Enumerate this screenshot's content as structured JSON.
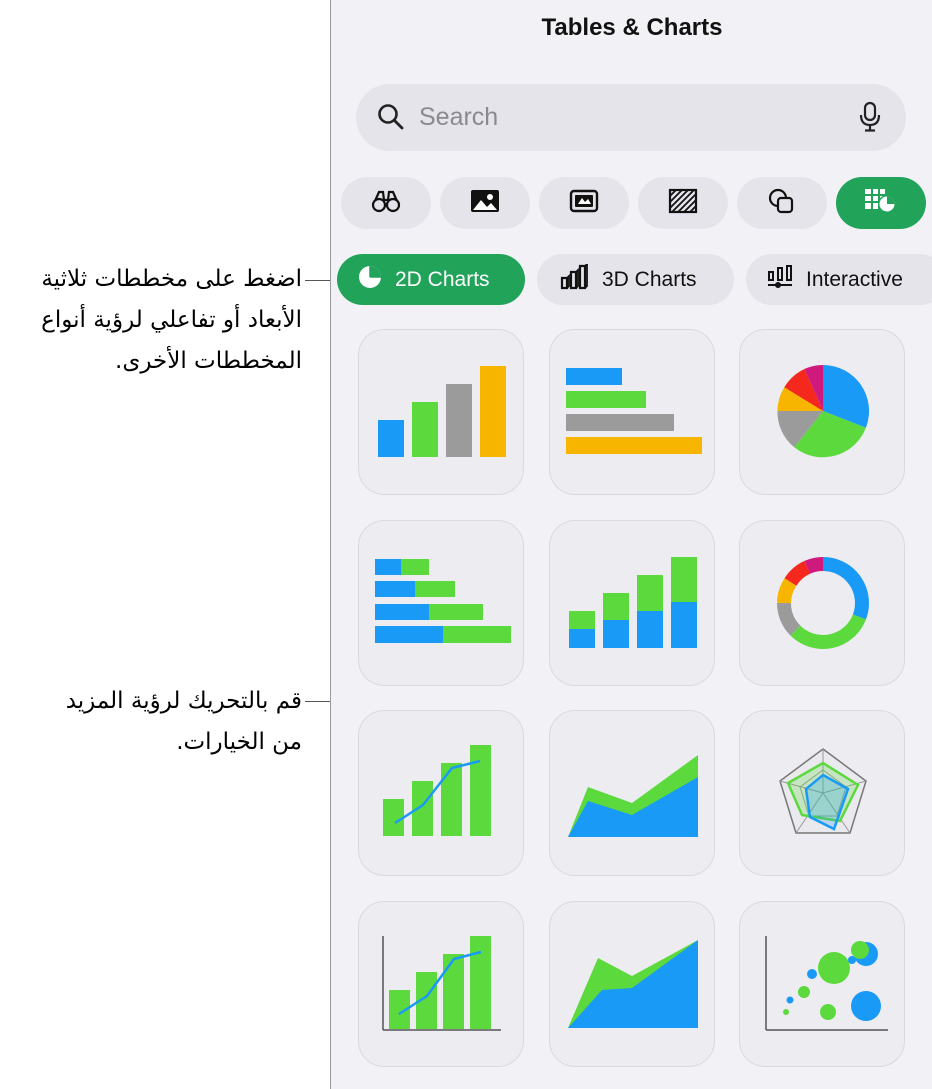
{
  "panel": {
    "title": "Tables & Charts"
  },
  "search": {
    "placeholder": "Search"
  },
  "categories": [
    {
      "name": "binoculars-icon",
      "active": false
    },
    {
      "name": "photo-icon",
      "active": false
    },
    {
      "name": "media-icon",
      "active": false
    },
    {
      "name": "pattern-icon",
      "active": false
    },
    {
      "name": "shapes-icon",
      "active": false
    },
    {
      "name": "table-chart-icon",
      "active": true
    }
  ],
  "segments": [
    {
      "label": "2D Charts",
      "icon": "pie-chart-icon",
      "active": true
    },
    {
      "label": "3D Charts",
      "icon": "3d-bar-chart-icon",
      "active": false
    },
    {
      "label": "Interactive",
      "icon": "interactive-chart-icon",
      "active": false
    }
  ],
  "chart_tiles": [
    "column-chart",
    "bar-chart",
    "pie-chart",
    "stacked-bar-chart",
    "stacked-column-chart",
    "donut-chart",
    "line-column-chart",
    "area-chart",
    "radar-chart",
    "axis-line-column-chart",
    "stacked-area-chart",
    "bubble-chart"
  ],
  "callouts": {
    "switch_chart_types": [
      "اضغط على مخططات ثلاثية",
      "الأبعاد أو تفاعلي لرؤية أنواع",
      "المخططات الأخرى."
    ],
    "scroll_more": [
      "قم بالتحريك لرؤية المزيد",
      "من الخيارات."
    ]
  },
  "colors": {
    "accent_green": "#21a35a",
    "chart_blue": "#1a9af7",
    "chart_green": "#5bd93d",
    "chart_gray": "#9b9b9b",
    "chart_yellow": "#f7b500",
    "chart_red": "#f5281e",
    "chart_magenta": "#d0197d"
  }
}
